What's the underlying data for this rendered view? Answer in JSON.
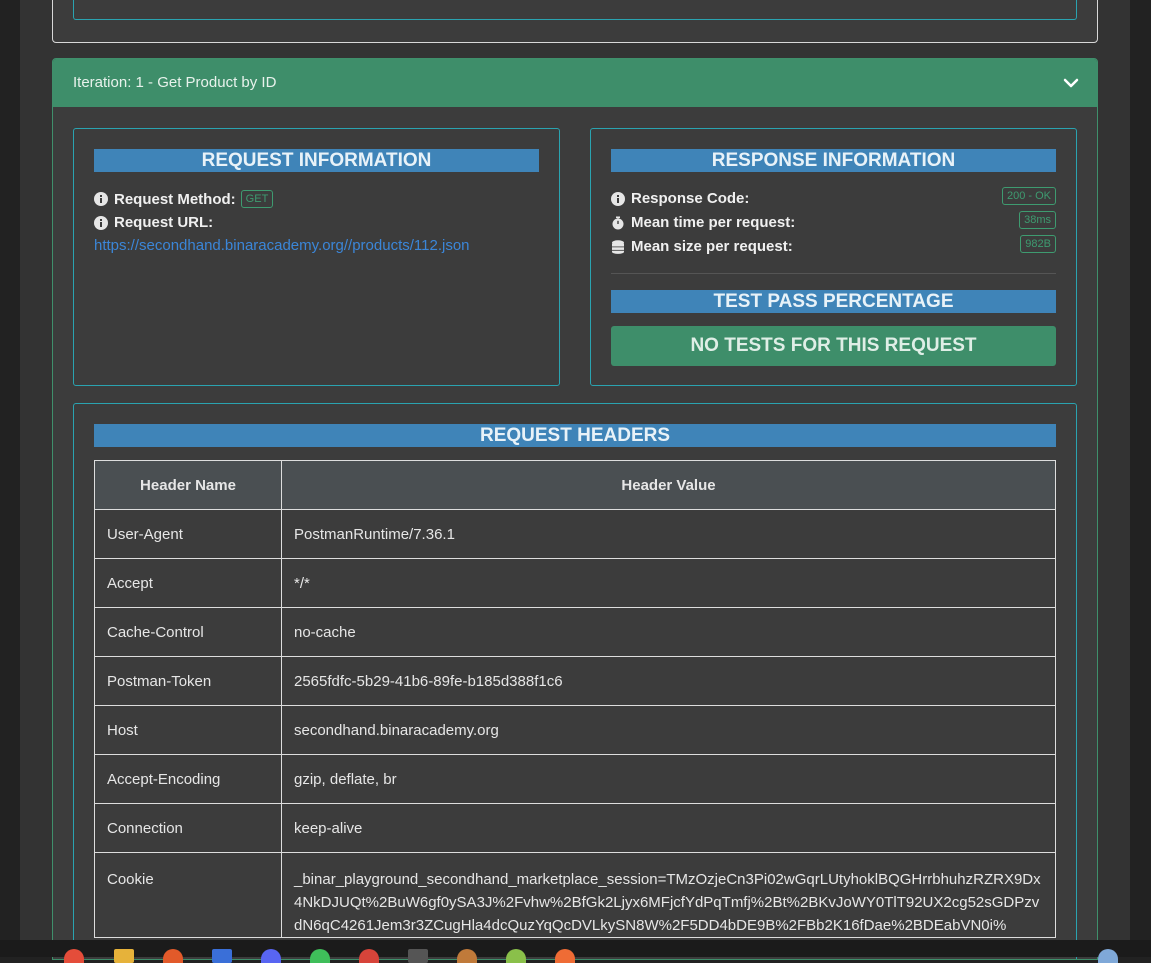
{
  "iteration": {
    "title": "Iteration: 1 - Get Product by ID"
  },
  "request_info": {
    "heading": "REQUEST INFORMATION",
    "method_label": "Request Method:",
    "method_value": "GET",
    "url_label": "Request URL:",
    "url_value": "https://secondhand.binaracademy.org//products/112.json"
  },
  "response_info": {
    "heading": "RESPONSE INFORMATION",
    "code_label": "Response Code:",
    "code_value": "200 - OK",
    "mean_time_label": "Mean time per request:",
    "mean_time_value": "38ms",
    "mean_size_label": "Mean size per request:",
    "mean_size_value": "982B"
  },
  "test_pass": {
    "heading": "TEST PASS PERCENTAGE",
    "status": "NO TESTS FOR THIS REQUEST"
  },
  "request_headers": {
    "heading": "REQUEST HEADERS",
    "columns": [
      "Header Name",
      "Header Value"
    ],
    "rows": [
      {
        "name": "User-Agent",
        "value": "PostmanRuntime/7.36.1"
      },
      {
        "name": "Accept",
        "value": "*/*"
      },
      {
        "name": "Cache-Control",
        "value": "no-cache"
      },
      {
        "name": "Postman-Token",
        "value": "2565fdfc-5b29-41b6-89fe-b185d388f1c6"
      },
      {
        "name": "Host",
        "value": "secondhand.binaracademy.org"
      },
      {
        "name": "Accept-Encoding",
        "value": "gzip, deflate, br"
      },
      {
        "name": "Connection",
        "value": "keep-alive"
      },
      {
        "name": "Cookie",
        "value": "_binar_playground_secondhand_marketplace_session=TMzOzjeCn3Pi02wGqrLUtyhoklBQGHrrbhuhzRZRX9Dx4NkDJUQt%2BuW6gf0ySA3J%2Fvhw%2BfGk2Ljyx6MFjcfYdPqTmfj%2Bt%2BKvJoWY0TlT92UX2cg52sGDPzvdN6qC4261Jem3r3ZCugHla4dcQuzYqQcDVLkySN8W%2F5DD4bDE9B%2FBb2K16fDae%2BDEabVN0i%"
      }
    ]
  },
  "colors": {
    "accent_green": "#3e8e6a",
    "section_blue": "#3f84b8",
    "panel_border": "#2aa3b0",
    "link_blue": "#3b86d8"
  }
}
